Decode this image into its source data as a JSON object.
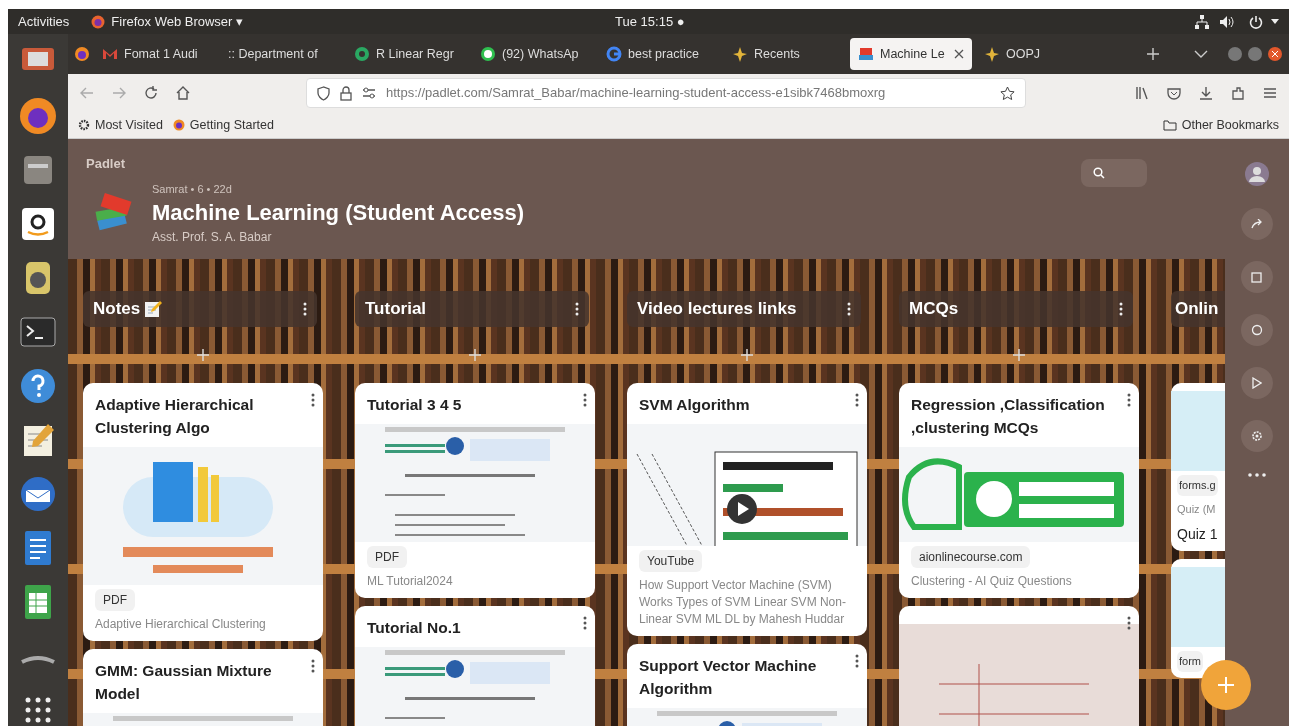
{
  "topbar": {
    "activities": "Activities",
    "app": "Firefox Web Browser ▾",
    "clock": "Tue 15:15 ●"
  },
  "tabs": [
    {
      "title": "Fomat 1 Audi",
      "selected": false
    },
    {
      "title": ":: Department of",
      "selected": false
    },
    {
      "title": "R Linear Regr",
      "selected": false
    },
    {
      "title": "(92) WhatsAp",
      "selected": false
    },
    {
      "title": "best practice",
      "selected": false
    },
    {
      "title": "Recents",
      "selected": false
    },
    {
      "title": "Machine Le",
      "selected": true
    },
    {
      "title": "OOPJ",
      "selected": false
    }
  ],
  "url": "https://padlet.com/Samrat_Babar/machine-learning-student-access-e1sibk7468bmoxrg",
  "bookmarks": [
    "Most Visited",
    "Getting Started"
  ],
  "other_bookmarks": "Other Bookmarks",
  "padlet": {
    "brand": "Padlet",
    "meta": "Samrat • 6 • 22d",
    "title": "Machine Learning (Student Access)",
    "subtitle": "Asst. Prof. S. A. Babar",
    "columns": [
      {
        "title": "Notes",
        "cards": [
          {
            "kind": "book",
            "title": "Adaptive Hierarchical Clustering Algo",
            "tag": "PDF",
            "caption": "Adaptive Hierarchical Clustering"
          },
          {
            "kind": "doc",
            "title": "GMM: Gaussian Mixture Model"
          }
        ]
      },
      {
        "title": "Tutorial",
        "cards": [
          {
            "kind": "doc",
            "title": "Tutorial 3 4 5",
            "tag": "PDF",
            "caption": "ML Tutorial2024"
          },
          {
            "kind": "doc",
            "title": "Tutorial No.1"
          }
        ]
      },
      {
        "title": "Video lectures links",
        "cards": [
          {
            "kind": "video",
            "title": "SVM Algorithm",
            "tag": "YouTube",
            "caption": "How Support Vector Machine (SVM) Works Types of SVM Linear SVM Non-Linear SVM ML DL by Mahesh Huddar"
          },
          {
            "kind": "doc",
            "title": "Support Vector Machine Algorithm"
          }
        ]
      },
      {
        "title": "MCQs",
        "cards": [
          {
            "kind": "logo",
            "title": "Regression ,Classification ,clustering  MCQs",
            "tag": "aionlinecourse.com",
            "caption": "Clustering - AI Quiz Questions"
          },
          {
            "kind": "photo"
          }
        ]
      },
      {
        "title": "Onlin",
        "cards": [
          {
            "kind": "form",
            "tag": "forms.g",
            "caption": "Quiz (M",
            "footer": "Quiz 1"
          },
          {
            "kind": "form",
            "tag": "form"
          }
        ]
      }
    ]
  }
}
